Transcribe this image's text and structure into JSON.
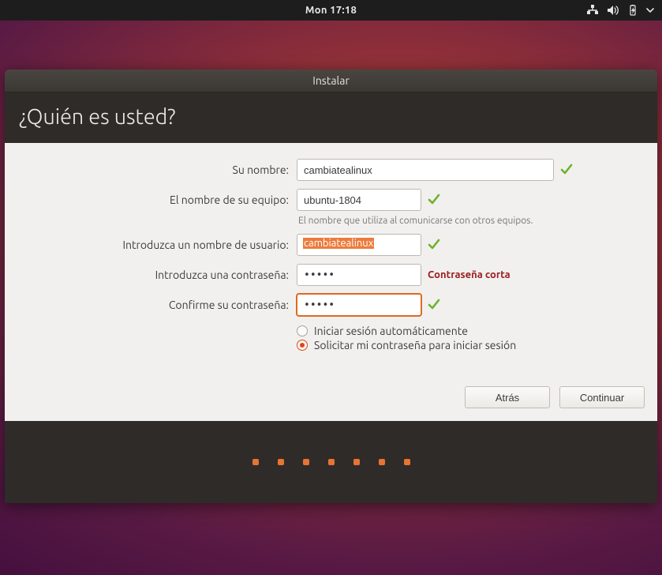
{
  "topbar": {
    "clock": "Mon 17:18"
  },
  "window": {
    "title": "Instalar"
  },
  "header": {
    "title": "¿Quién es usted?"
  },
  "form": {
    "name": {
      "label": "Su nombre:",
      "value": "cambiatealinux"
    },
    "host": {
      "label": "El nombre de su equipo:",
      "value": "ubuntu-1804",
      "hint": "El nombre que utiliza al comunicarse con otros equipos."
    },
    "user": {
      "label": "Introduzca un nombre de usuario:",
      "value": "cambiatealinux"
    },
    "pass": {
      "label": "Introduzca una contraseña:",
      "value": "•••••",
      "warn": "Contraseña corta"
    },
    "confirm": {
      "label": "Confirme su contraseña:",
      "value": "•••••"
    },
    "login": {
      "auto": "Iniciar sesión automáticamente",
      "require": "Solicitar mi contraseña para iniciar sesión",
      "selected": "require"
    }
  },
  "buttons": {
    "back": "Atrás",
    "continue": "Continuar"
  }
}
